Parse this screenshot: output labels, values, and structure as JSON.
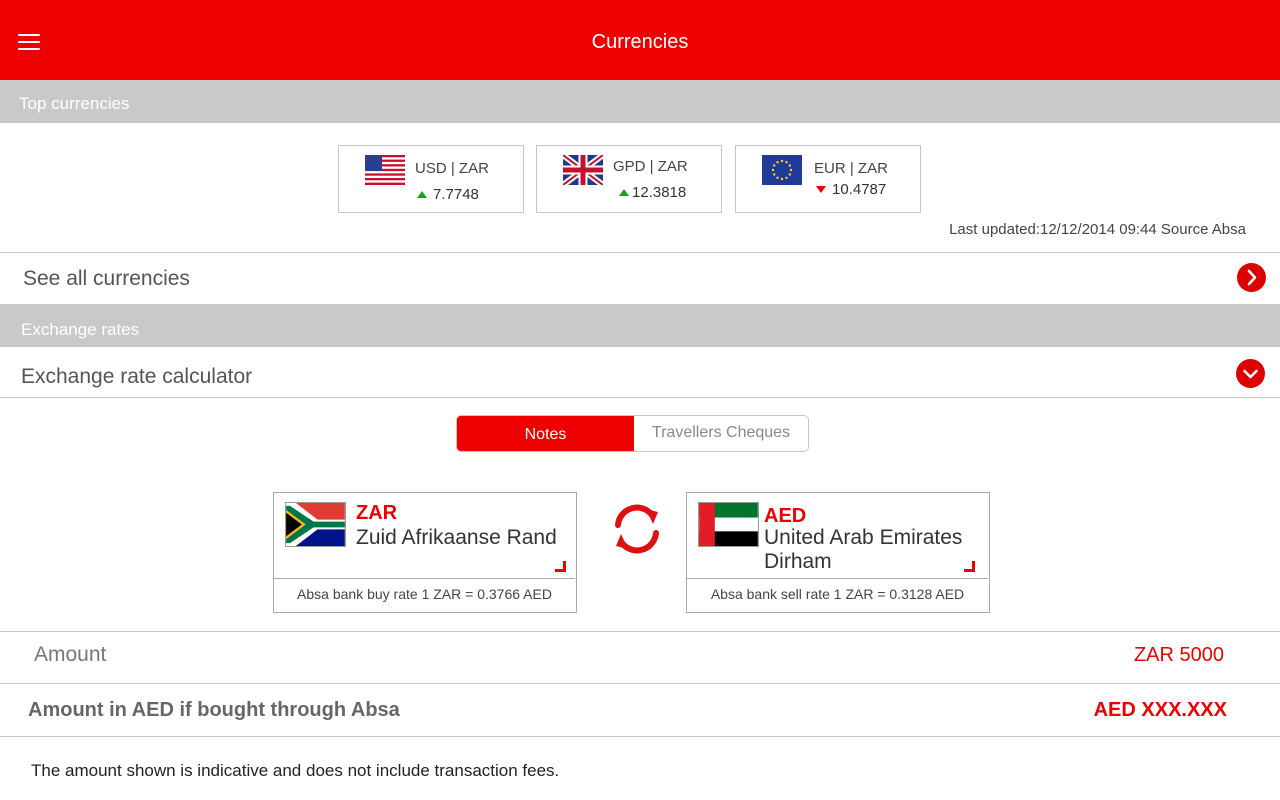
{
  "appbar": {
    "title": "Currencies"
  },
  "top_currencies": {
    "header": "Top currencies",
    "items": [
      {
        "pair": "USD | ZAR",
        "rate": "7.7748",
        "trend": "up",
        "flag_icon": "us-flag-icon"
      },
      {
        "pair": "GPD | ZAR",
        "rate": "12.3818",
        "trend": "up",
        "flag_icon": "uk-flag-icon"
      },
      {
        "pair": "EUR | ZAR",
        "rate": "10.4787",
        "trend": "down",
        "flag_icon": "eu-flag-icon"
      }
    ],
    "last_updated": "Last updated:12/12/2014 09:44 Source Absa"
  },
  "see_all": {
    "label": "See all currencies"
  },
  "exchange_rates": {
    "header": "Exchange rates",
    "calculator_label": "Exchange rate calculator",
    "tabs": {
      "notes": "Notes",
      "travellers_cheques": "Travellers Cheques",
      "selected": "notes"
    },
    "from": {
      "code": "ZAR",
      "name": "Zuid Afrikaanse Rand",
      "rate_text": "Absa bank buy rate 1 ZAR = 0.3766 AED",
      "flag_icon": "south-africa-flag-icon"
    },
    "to": {
      "code": "AED",
      "name": "United Arab Emirates Dirham",
      "rate_text": "Absa bank sell rate 1 ZAR = 0.3128 AED",
      "flag_icon": "uae-flag-icon"
    },
    "amount_label": "Amount",
    "amount_value": "ZAR 5000",
    "result_label": "Amount in AED if bought through Absa",
    "result_value": "AED XXX.XXX",
    "disclaimer": "The amount shown is indicative and does not include transaction fees."
  },
  "colors": {
    "brand_red": "#ee0000",
    "section_gray": "#c8c9cb",
    "trend_up": "#1aa11a",
    "trend_down": "#ee0000"
  }
}
